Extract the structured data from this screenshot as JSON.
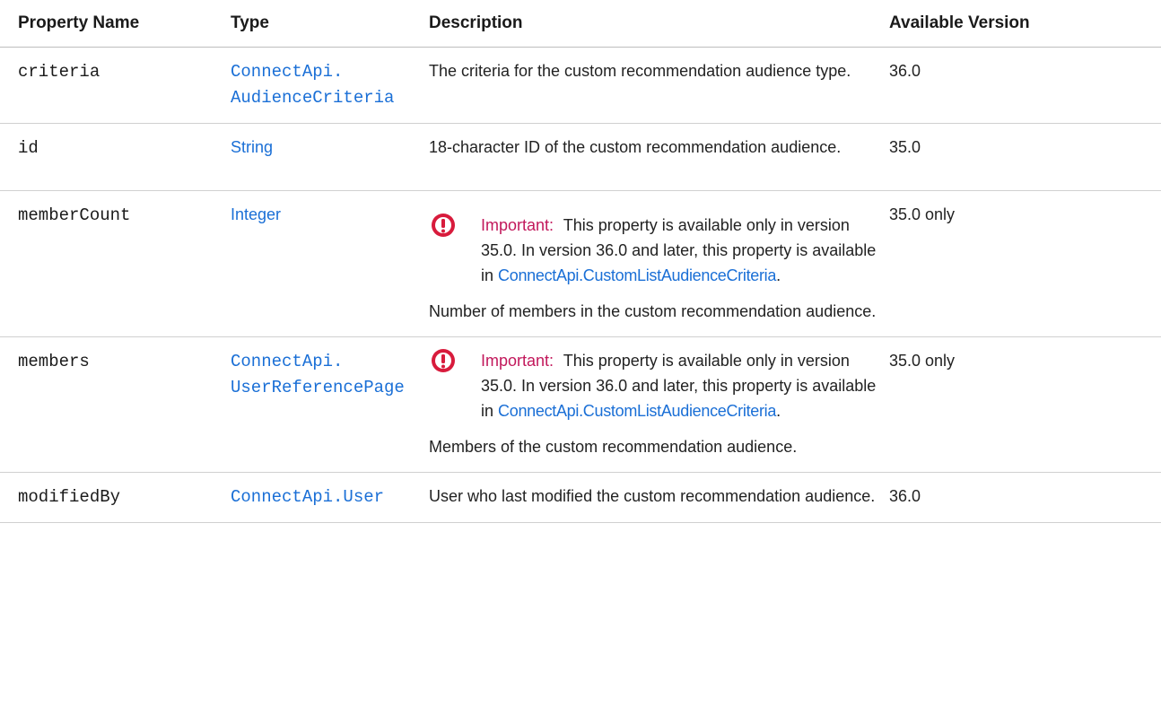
{
  "table": {
    "headers": {
      "name": "Property Name",
      "type": "Type",
      "description": "Description",
      "version": "Available Version"
    },
    "rows": [
      {
        "name": "criteria",
        "type_line1": "ConnectApi.",
        "type_line2": "AudienceCriteria",
        "description": "The criteria for the custom recommendation audience type.",
        "version": "36.0"
      },
      {
        "name": "id",
        "type": "String",
        "description": "18-character ID of the custom recommendation audience.",
        "version": "35.0"
      },
      {
        "name": "memberCount",
        "type": "Integer",
        "important_label": "Important:",
        "important_text": "This property is available only in version 35.0. In version 36.0 and later, this property is available in",
        "important_link": "ConnectApi.CustomListAudienceCriteria",
        "important_suffix": ".",
        "description": "Number of members in the custom recommendation audience.",
        "version": "35.0 only"
      },
      {
        "name": "members",
        "type_line1": "ConnectApi.",
        "type_line2": "UserReferencePage",
        "important_label": "Important:",
        "important_text": "This property is available only in version 35.0. In version 36.0 and later, this property is available in",
        "important_link": "ConnectApi.CustomListAudienceCriteria",
        "important_suffix": ".",
        "description": "Members of the custom recommendation audience.",
        "version": "35.0 only"
      },
      {
        "name": "modifiedBy",
        "type": "ConnectApi.User",
        "description": "User who last modified the custom recommendation audience.",
        "version": "36.0"
      }
    ]
  },
  "colors": {
    "link": "#1a6fd6",
    "important": "#c2185b",
    "important_icon": "#d81b3c"
  },
  "icons": {
    "important": "exclamation-circle-icon"
  }
}
